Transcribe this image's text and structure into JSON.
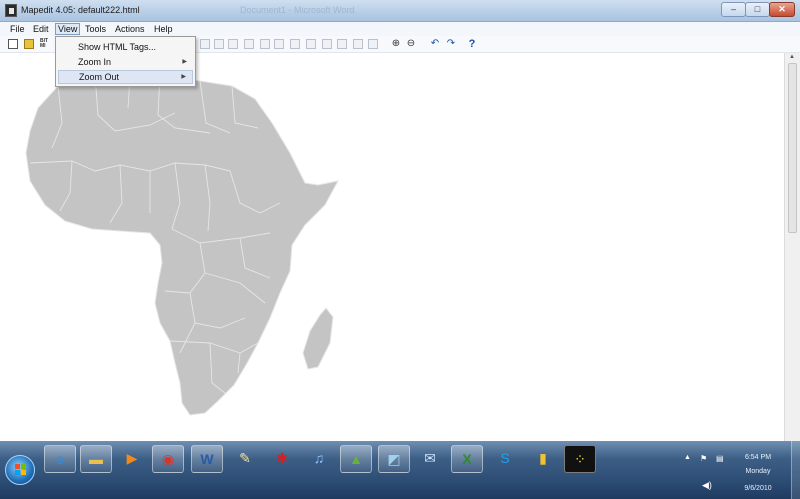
{
  "window": {
    "title": "Mapedit 4.05: default222.html",
    "ghost_title": "Document1 - Microsoft Word",
    "controls": {
      "minimize": "–",
      "maximize": "□",
      "close": "✕"
    }
  },
  "menubar": {
    "items": [
      "File",
      "Edit",
      "View",
      "Tools",
      "Actions",
      "Help"
    ],
    "active": "View"
  },
  "toolbar": {
    "bit_icon_label": "BIT MI",
    "icons": [
      "new-document-icon",
      "open-folder-icon",
      "bitmap-icon",
      "shape-tool-icons",
      "zoom-in-icon",
      "zoom-out-icon",
      "undo-icon",
      "redo-icon",
      "help-icon"
    ],
    "help_glyph": "?"
  },
  "view_menu": {
    "items": [
      {
        "label": "Show HTML Tags...",
        "submenu": false
      },
      {
        "label": "Zoom In",
        "submenu": true
      },
      {
        "label": "Zoom Out",
        "submenu": true
      }
    ],
    "highlighted": "Zoom Out"
  },
  "map": {
    "region": "Africa",
    "fill_color": "#c4c4c4",
    "border_color": "#e2e2e2"
  },
  "taskbar": {
    "pinned_icons": [
      "internet-explorer-icon",
      "file-explorer-icon",
      "media-player-icon",
      "chrome-icon",
      "word-icon",
      "notepad-icon",
      "paint-splat-icon",
      "itunes-icon",
      "photo-viewer-icon",
      "images-icon",
      "mail-icon",
      "excel-icon",
      "skype-icon",
      "usb-icon",
      "network-map-icon"
    ],
    "clock": {
      "time": "6:54 PM",
      "day": "Monday",
      "date": "9/6/2010"
    }
  }
}
